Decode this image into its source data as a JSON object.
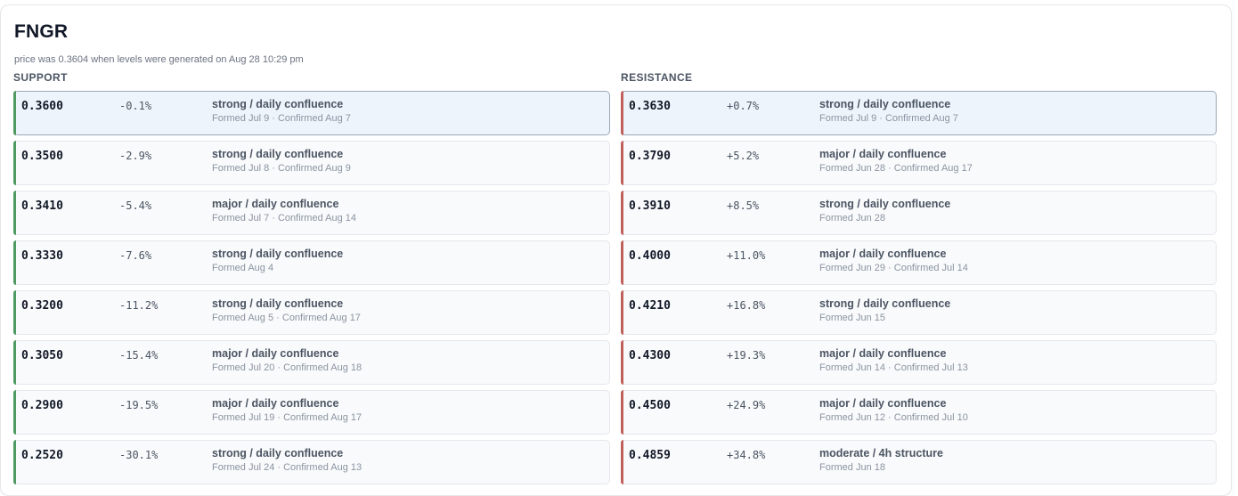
{
  "ticker": "FNGR",
  "subtitle": "price was 0.3604 when levels were generated on Aug 28 10:29 pm",
  "colors": {
    "support_accent": "#4e9a62",
    "resistance_accent": "#c0605d",
    "active_bg": "#eef4fb"
  },
  "support": {
    "heading": "SUPPORT",
    "rows": [
      {
        "price": "0.3600",
        "pct": "-0.1%",
        "kind": "strong / daily confluence",
        "meta": "Formed Jul 9 · Confirmed Aug 7",
        "active": true
      },
      {
        "price": "0.3500",
        "pct": "-2.9%",
        "kind": "strong / daily confluence",
        "meta": "Formed Jul 8 · Confirmed Aug 9"
      },
      {
        "price": "0.3410",
        "pct": "-5.4%",
        "kind": "major / daily confluence",
        "meta": "Formed Jul 7 · Confirmed Aug 14"
      },
      {
        "price": "0.3330",
        "pct": "-7.6%",
        "kind": "strong / daily confluence",
        "meta": "Formed Aug 4"
      },
      {
        "price": "0.3200",
        "pct": "-11.2%",
        "kind": "strong / daily confluence",
        "meta": "Formed Aug 5 · Confirmed Aug 17"
      },
      {
        "price": "0.3050",
        "pct": "-15.4%",
        "kind": "major / daily confluence",
        "meta": "Formed Jul 20 · Confirmed Aug 18"
      },
      {
        "price": "0.2900",
        "pct": "-19.5%",
        "kind": "major / daily confluence",
        "meta": "Formed Jul 19 · Confirmed Aug 17"
      },
      {
        "price": "0.2520",
        "pct": "-30.1%",
        "kind": "strong / daily confluence",
        "meta": "Formed Jul 24 · Confirmed Aug 13"
      }
    ]
  },
  "resistance": {
    "heading": "RESISTANCE",
    "rows": [
      {
        "price": "0.3630",
        "pct": "+0.7%",
        "kind": "strong / daily confluence",
        "meta": "Formed Jul 9 · Confirmed Aug 7",
        "active": true
      },
      {
        "price": "0.3790",
        "pct": "+5.2%",
        "kind": "major / daily confluence",
        "meta": "Formed Jun 28 · Confirmed Aug 17"
      },
      {
        "price": "0.3910",
        "pct": "+8.5%",
        "kind": "strong / daily confluence",
        "meta": "Formed Jun 28"
      },
      {
        "price": "0.4000",
        "pct": "+11.0%",
        "kind": "major / daily confluence",
        "meta": "Formed Jun 29 · Confirmed Jul 14"
      },
      {
        "price": "0.4210",
        "pct": "+16.8%",
        "kind": "strong / daily confluence",
        "meta": "Formed Jun 15"
      },
      {
        "price": "0.4300",
        "pct": "+19.3%",
        "kind": "major / daily confluence",
        "meta": "Formed Jun 14 · Confirmed Jul 13"
      },
      {
        "price": "0.4500",
        "pct": "+24.9%",
        "kind": "major / daily confluence",
        "meta": "Formed Jun 12 · Confirmed Jul 10"
      },
      {
        "price": "0.4859",
        "pct": "+34.8%",
        "kind": "moderate / 4h structure",
        "meta": "Formed Jun 18"
      }
    ]
  }
}
